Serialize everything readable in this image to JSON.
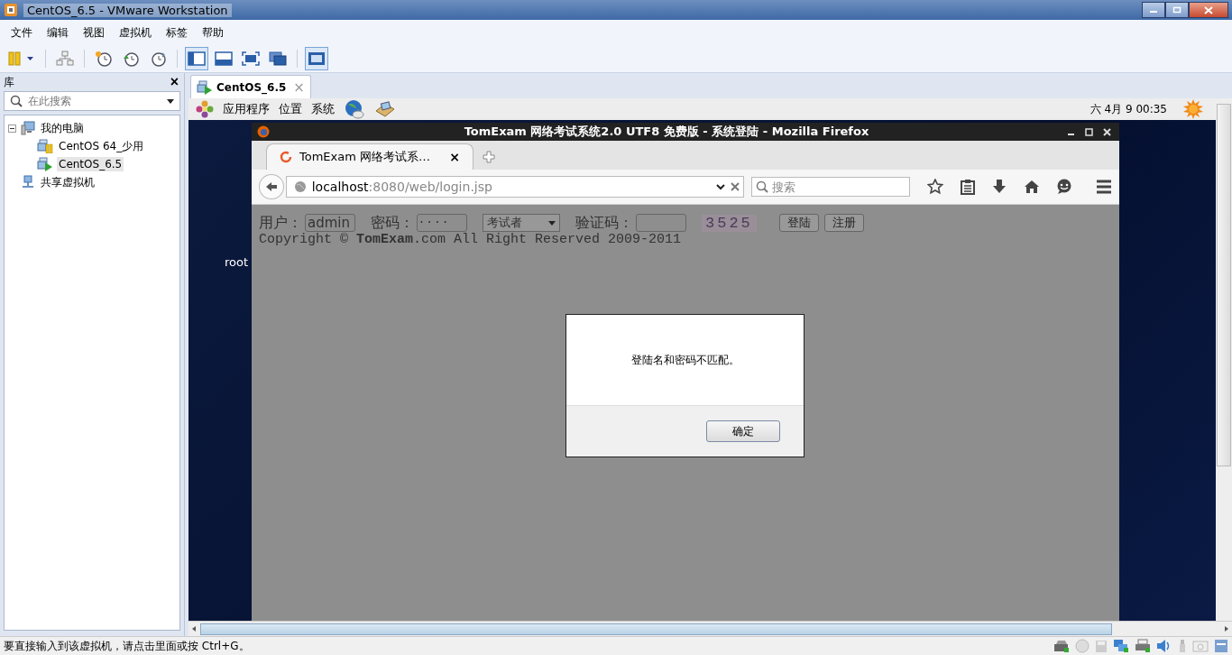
{
  "window": {
    "title": "CentOS_6.5 - VMware Workstation"
  },
  "menu": [
    "文件",
    "编辑",
    "视图",
    "虚拟机",
    "标签",
    "帮助"
  ],
  "toolbar": [
    {
      "kind": "pause",
      "selected": false
    },
    {
      "kind": "network",
      "selected": false
    },
    {
      "kind": "snapshot",
      "selected": false
    },
    {
      "kind": "revert",
      "selected": false
    },
    {
      "kind": "manage",
      "selected": false
    },
    {
      "kind": "sidebar",
      "selected": true
    },
    {
      "kind": "console",
      "selected": false
    },
    {
      "kind": "fullscreen",
      "selected": false
    },
    {
      "kind": "unity",
      "selected": false
    },
    {
      "kind": "thumbnail",
      "selected": true
    }
  ],
  "library": {
    "title": "库",
    "close": "×",
    "search": {
      "placeholder": "在此搜索"
    },
    "tree": [
      {
        "label": "我的电脑",
        "kind": "computer",
        "expanded": true,
        "selected": false,
        "children": [
          {
            "label": "CentOS 64_少用",
            "paused": true,
            "selected": false
          },
          {
            "label": "CentOS_6.5",
            "paused": false,
            "selected": true
          }
        ]
      },
      {
        "label": "共享虚拟机",
        "kind": "shared",
        "selected": false
      }
    ]
  },
  "vm_tabs": [
    {
      "label": "CentOS_6.5",
      "close": "×",
      "selected": true
    }
  ],
  "guest": {
    "panel_menu": [
      "应用程序",
      "位置",
      "系统"
    ],
    "clock": "六 4月  9 00:35",
    "desktop_label": "root",
    "browser": {
      "title": "TomExam 网络考试系统2.0 UTF8 免费版 - 系统登陆 - Mozilla Firefox",
      "tabs": [
        {
          "label": "TomExam 网络考试系…",
          "close": "×",
          "selected": true
        }
      ],
      "url_host": "localhost",
      "url_rest": ":8080/web/login.jsp",
      "search_placeholder": "搜索",
      "form": {
        "user_label": "用户：",
        "user_value": "admin",
        "password_label": "密码：",
        "password_value": "····",
        "role": "考试者",
        "captcha_label": "验证码：",
        "captcha": "3525",
        "buttons": [
          "登陆",
          "注册"
        ]
      },
      "copyright": "Copyright © **TomExam**.com All Right Reserved 2009-2011",
      "dialog": {
        "message": "登陆名和密码不匹配。",
        "button": "确定"
      }
    }
  },
  "status_bar": "要直接输入到该虚拟机，请点击里面或按 Ctrl+G。"
}
